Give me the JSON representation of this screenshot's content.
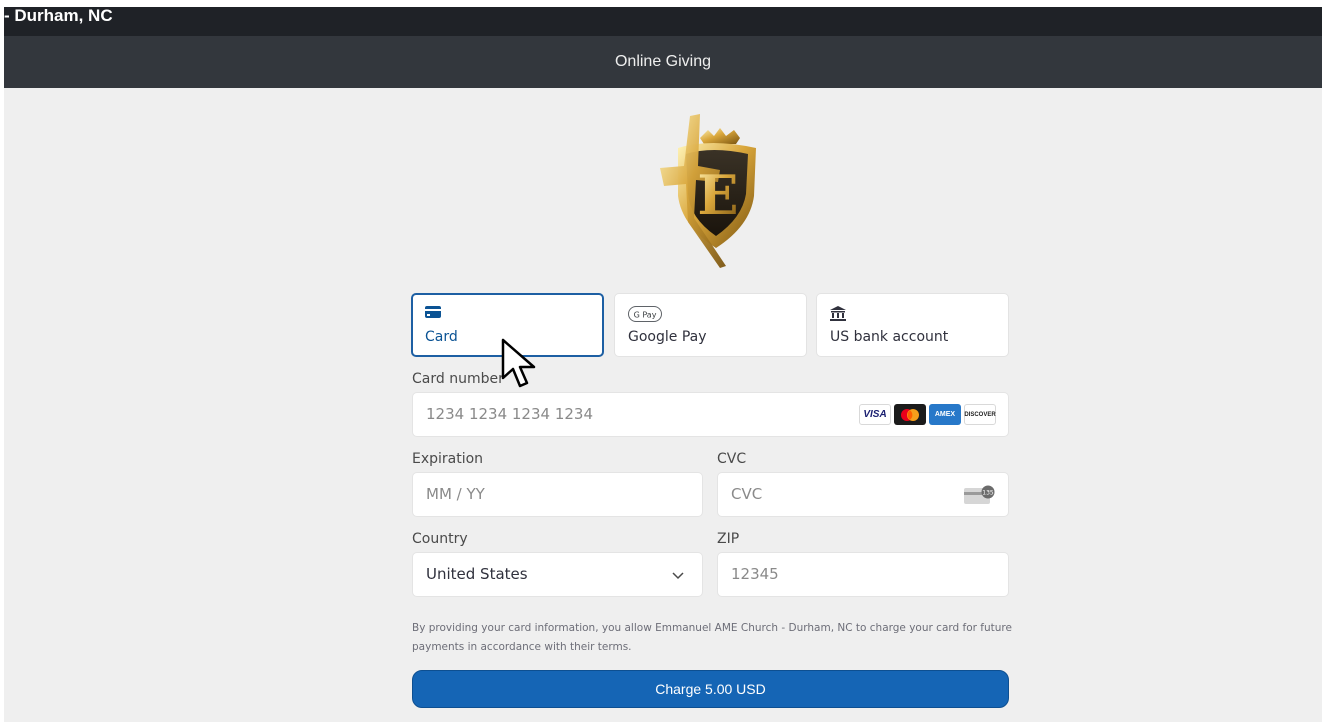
{
  "site": {
    "title": "- Durham, NC"
  },
  "header": {
    "title": "Online Giving"
  },
  "payment_methods": [
    {
      "label": "Card",
      "icon": "credit-card-icon",
      "selected": true
    },
    {
      "label": "Google Pay",
      "icon": "google-pay-icon",
      "badge": "G Pay",
      "selected": false
    },
    {
      "label": "US bank account",
      "icon": "bank-icon",
      "selected": false
    }
  ],
  "card_number": {
    "label": "Card number",
    "placeholder": "1234 1234 1234 1234",
    "brands": [
      "VISA",
      "Mastercard",
      "AMEX",
      "DISCOVER"
    ]
  },
  "expiration": {
    "label": "Expiration",
    "placeholder": "MM / YY"
  },
  "cvc": {
    "label": "CVC",
    "placeholder": "CVC",
    "icon_text": "135"
  },
  "country": {
    "label": "Country",
    "value": "United States"
  },
  "zip": {
    "label": "ZIP",
    "placeholder": "12345"
  },
  "terms": "By providing your card information, you allow Emmanuel AME Church - Durham, NC to charge your card for future payments in accordance with their terms.",
  "charge_button": {
    "label": "Charge 5.00 USD"
  },
  "colors": {
    "accent": "#1565b5",
    "header_bg": "#33373d",
    "top_bg": "#1f2227",
    "page_bg": "#efefef"
  }
}
